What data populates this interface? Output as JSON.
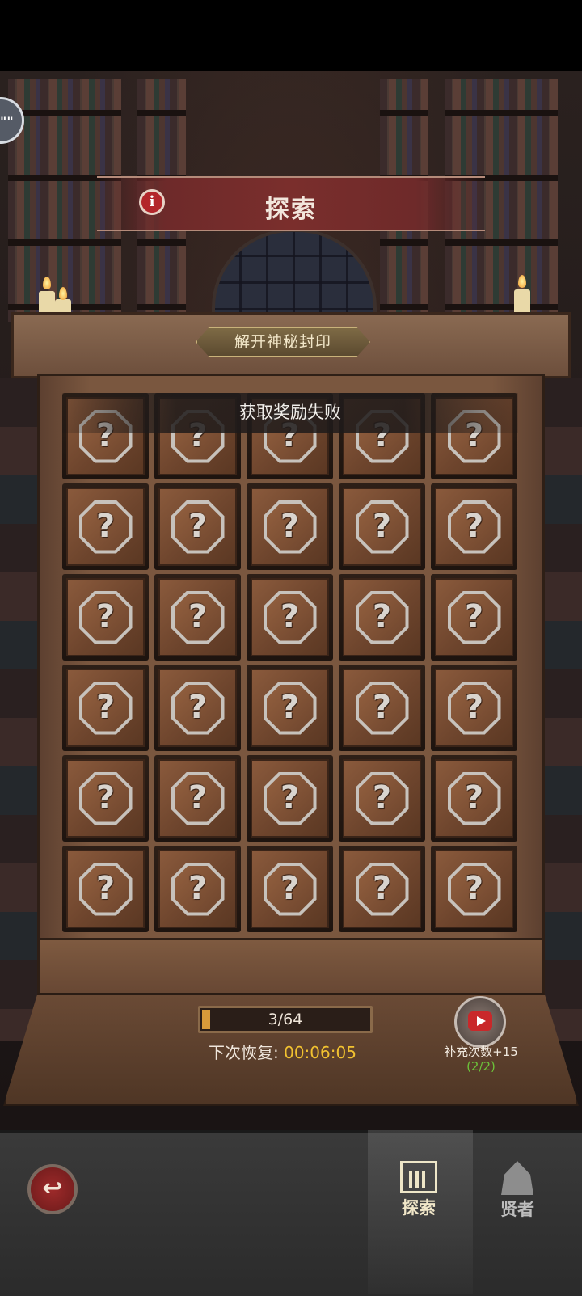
{
  "header": {
    "title": "探索",
    "info_icon": "i",
    "chat_icon": "\"\""
  },
  "board": {
    "seal_label": "解开神秘封印",
    "toast": "获取奖励失败",
    "tile_symbol": "?",
    "rows": 6,
    "cols": 5
  },
  "progress": {
    "text": "3/64",
    "fraction": 0.047,
    "recover_label": "下次恢复:",
    "recover_time": "00:06:05"
  },
  "refill": {
    "label": "补充次数+15",
    "count": "(2/2)"
  },
  "bottom_nav": {
    "back_icon": "↩",
    "tabs": [
      {
        "label": "探索",
        "icon": "bookshelf-icon",
        "active": true
      },
      {
        "label": "贤者",
        "icon": "hood-icon",
        "active": false
      }
    ]
  },
  "colors": {
    "banner": "#7a2e2c",
    "timer": "#f2c230",
    "refill_count": "#6cc23a",
    "video": "#c9282a"
  }
}
